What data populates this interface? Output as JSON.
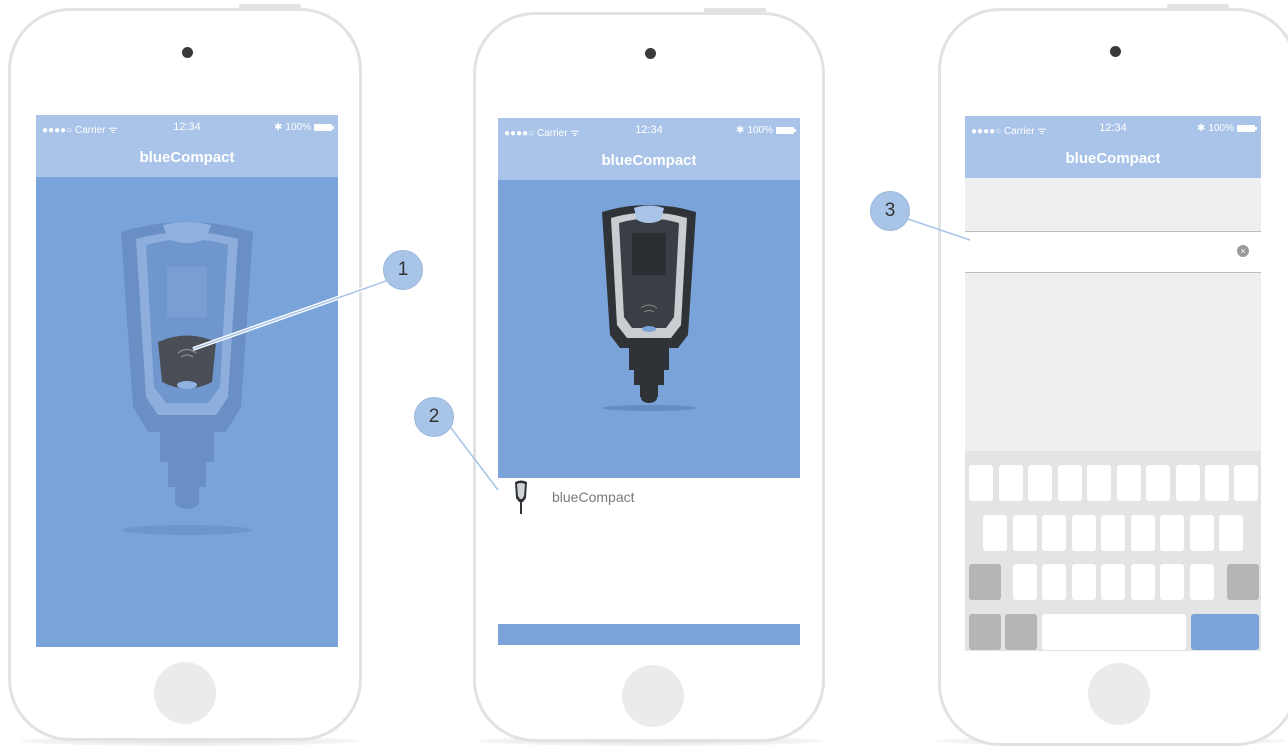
{
  "status_bar": {
    "carrier": "●●●●○ Carrier ᯤ",
    "time": "12:34",
    "battery": "100%",
    "bluetooth": "✱"
  },
  "app_title": "blueCompact",
  "callouts": [
    "1",
    "2",
    "3"
  ],
  "screens": {
    "screen2": {
      "list_item_label": "blueCompact"
    }
  },
  "colors": {
    "accent": "#7aa3da",
    "bar": "#a9c4e8",
    "phone_frame": "#e2e2e2"
  },
  "icons": {
    "clear_field": "clear-icon",
    "key_device": "key-icon"
  }
}
